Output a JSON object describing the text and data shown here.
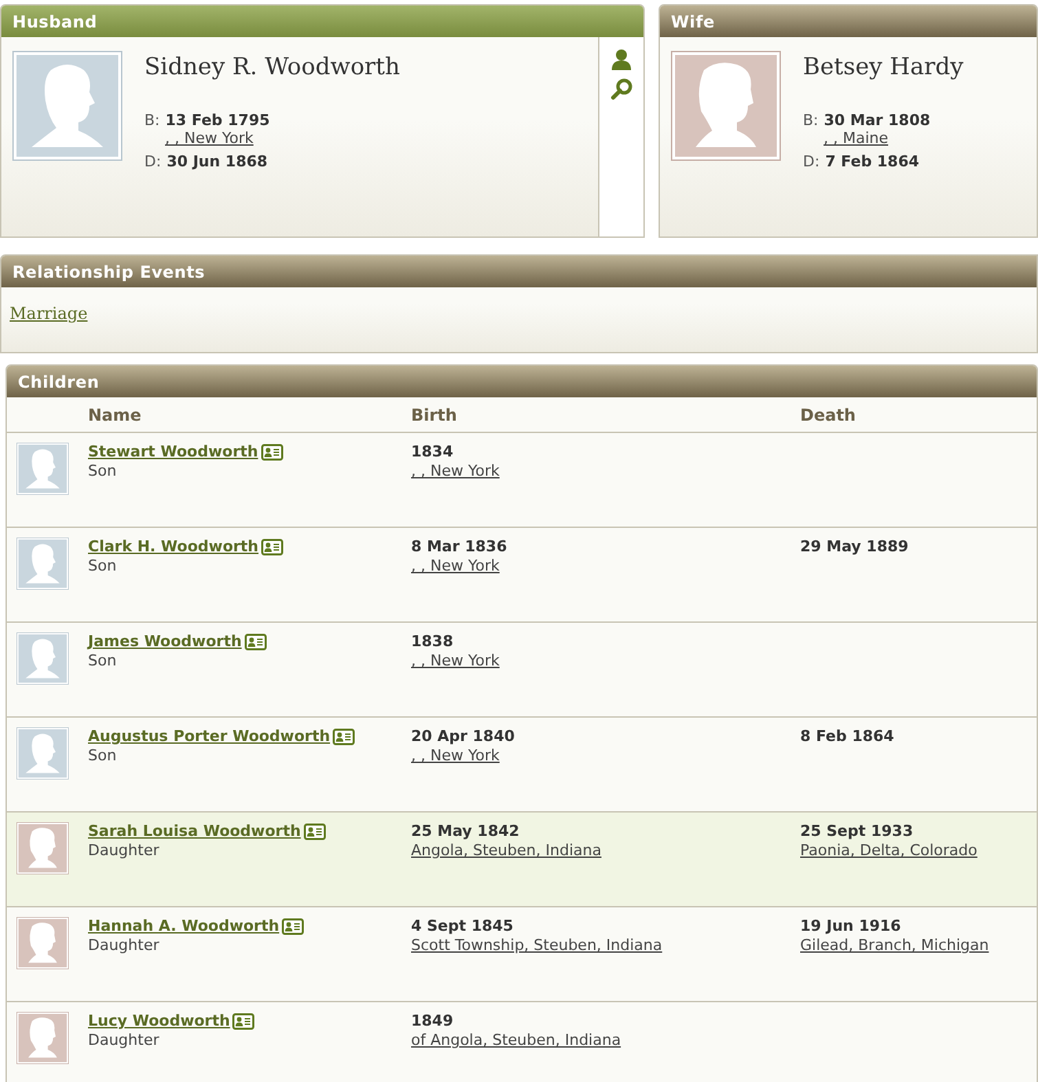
{
  "husband": {
    "header": "Husband",
    "kind": "male",
    "name": "Sidney R. Woodworth",
    "birth_label": "B:",
    "birth_date": "13 Feb 1795",
    "birth_place": ", , New York",
    "death_label": "D:",
    "death_date": "30 Jun 1868"
  },
  "wife": {
    "header": "Wife",
    "kind": "female",
    "name": "Betsey Hardy",
    "birth_label": "B:",
    "birth_date": "30 Mar 1808",
    "birth_place": ", , Maine",
    "death_label": "D:",
    "death_date": "7 Feb 1864"
  },
  "relationship_events": {
    "header": "Relationship Events",
    "links": [
      "Marriage"
    ]
  },
  "children": {
    "header": "Children",
    "columns": [
      "Name",
      "Birth",
      "Death"
    ],
    "rows": [
      {
        "kind": "male",
        "selected": false,
        "name": "Stewart Woodworth",
        "relation": "Son",
        "birth_date": "1834",
        "birth_place": ", , New York"
      },
      {
        "kind": "male",
        "selected": false,
        "name": "Clark H. Woodworth",
        "relation": "Son",
        "birth_date": "8 Mar 1836",
        "birth_place": ", , New York",
        "death_date": "29 May 1889"
      },
      {
        "kind": "male",
        "selected": false,
        "name": "James Woodworth",
        "relation": "Son",
        "birth_date": "1838",
        "birth_place": ", , New York"
      },
      {
        "kind": "male",
        "selected": false,
        "name": "Augustus Porter Woodworth",
        "relation": "Son",
        "birth_date": "20 Apr 1840",
        "birth_place": ", , New York",
        "death_date": "8 Feb 1864"
      },
      {
        "kind": "female",
        "selected": true,
        "name": "Sarah Louisa Woodworth",
        "relation": "Daughter",
        "birth_date": "25 May 1842",
        "birth_place": "Angola, Steuben, Indiana",
        "death_date": "25 Sept 1933",
        "death_place": "Paonia, Delta, Colorado"
      },
      {
        "kind": "female",
        "selected": false,
        "name": "Hannah A. Woodworth",
        "relation": "Daughter",
        "birth_date": "4 Sept 1845",
        "birth_place": "Scott Township, Steuben, Indiana",
        "death_date": "19 Jun 1916",
        "death_place": "Gilead, Branch, Michigan"
      },
      {
        "kind": "female",
        "selected": false,
        "name": "Lucy Woodworth",
        "relation": "Daughter",
        "birth_date": "1849",
        "birth_place": "of Angola, Steuben, Indiana"
      }
    ]
  }
}
